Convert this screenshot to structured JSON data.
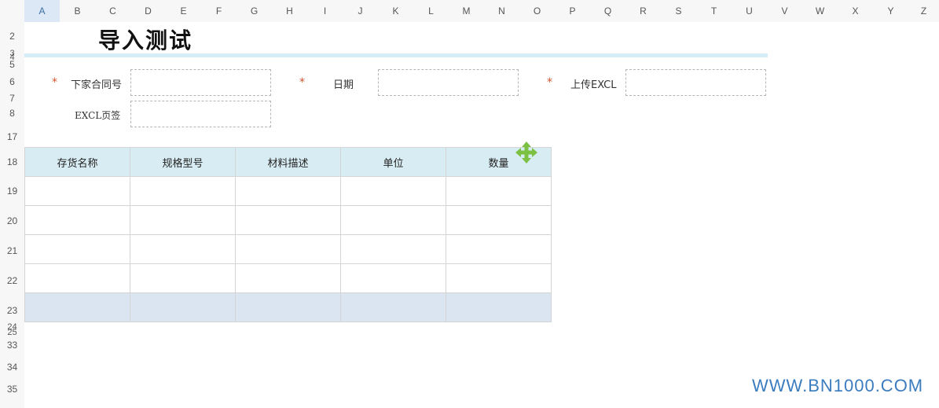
{
  "columns": [
    "A",
    "B",
    "C",
    "D",
    "E",
    "F",
    "G",
    "H",
    "I",
    "J",
    "K",
    "L",
    "M",
    "N",
    "O",
    "P",
    "Q",
    "R",
    "S",
    "T",
    "U",
    "V",
    "W",
    "X",
    "Y",
    "Z"
  ],
  "selected_column": "A",
  "rows": [
    "2",
    "3",
    "4",
    "5",
    "6",
    "7",
    "8",
    "17",
    "18",
    "19",
    "20",
    "21",
    "22",
    "23",
    "24",
    "25",
    "33",
    "34",
    "35"
  ],
  "title": "导入测试",
  "form": {
    "required_mark": "*",
    "contract_label": "下家合同号",
    "date_label": "日期",
    "upload_label": "上传EXCL",
    "sheet_label": "EXCL页签",
    "contract_value": "",
    "date_value": "",
    "upload_value": "",
    "sheet_value": ""
  },
  "table": {
    "headers": [
      "存货名称",
      "规格型号",
      "材料描述",
      "单位",
      "数量"
    ],
    "rows": [
      [
        "",
        "",
        "",
        "",
        ""
      ],
      [
        "",
        "",
        "",
        "",
        ""
      ],
      [
        "",
        "",
        "",
        "",
        ""
      ],
      [
        "",
        "",
        "",
        "",
        ""
      ]
    ],
    "footer": [
      "",
      "",
      "",
      "",
      ""
    ]
  },
  "icons": {
    "move": "move-arrows-icon"
  },
  "colors": {
    "accent_green": "#7cc142",
    "required": "#d2542b",
    "header_bg": "#d8ecf3",
    "footer_bg": "#dbe5f1"
  },
  "watermark": "WWW.BN1000.COM"
}
